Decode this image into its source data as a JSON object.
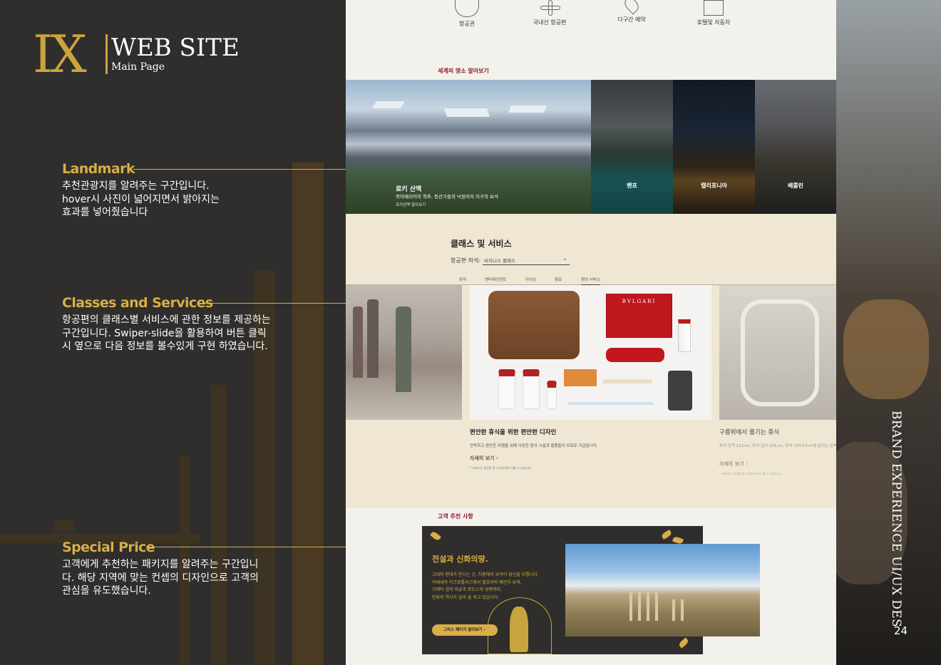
{
  "brand": {
    "mark": "IX",
    "title": "WEB SITE",
    "subtitle": "Main Page"
  },
  "annotations": [
    {
      "title": "Landmark",
      "text": "추천관광지를 알려주는 구간입니다.\nhover시 사진이 넓어지면서 밝아지는\n효과를 넣어줬습니다"
    },
    {
      "title": "Classes and Services",
      "text": "항공편의 클래스별 서비스에 관한 정보를 제공하는\n구간입니다. Swiper-slide을 활용하여 버튼 클릭\n시 옆으로 다음 정보를 볼수있게 구현 하였습니다."
    },
    {
      "title": "Special Price",
      "text": "고객에게 추천하는 패키지를 알려주는 구간입니\n다. 해당 지역에 맞는 컨셉의 디자인으로 고객의\n관심을 유도했습니다."
    }
  ],
  "quick_menu": [
    {
      "label": "항공권",
      "icon": "globe-icon"
    },
    {
      "label": "국내선 항공편",
      "icon": "airplane-icon"
    },
    {
      "label": "다구간 예약",
      "icon": "map-pin-icon"
    },
    {
      "label": "호텔및 자동차",
      "icon": "building-icon"
    }
  ],
  "landmark": {
    "section_label": "세계의 명소 알아보기",
    "featured": {
      "title": "로키 산맥",
      "desc": "북아메리카의 척추, 등산가들의 낙원이자 지구의 보석",
      "more": "로키산맥 알아보기"
    },
    "places": [
      "밴프",
      "캘리포니아",
      "베를린"
    ]
  },
  "classes": {
    "title": "클래스 및 서비스",
    "seat_label": "항공편 좌석:",
    "seat_value": "비지니스 클래스",
    "tabs": [
      "좌석",
      "엔터테인먼트",
      "다이닝",
      "음료",
      "편의 서비스"
    ],
    "product_brand": "BVLGARI",
    "slides": [
      {
        "title": "편안한 휴식을 위한 편안한 디자인",
        "desc": "안락하고 편안한 여행을 위해 다양한 편의 시설과 물품들이 무료로 지급됩니다.",
        "more": "자세히 보기",
        "note": "* 서비스는 항공편 및 노선에 따라 다를 수 있습니다."
      },
      {
        "title": "구름위에서 즐기는 휴식",
        "desc": "좌석 간격 211cm, 좌석 길이 201cm, 좌석 너비 67cm에 달하는 완벽한 평면 침대로 편안한 휴식을 제공합니다.",
        "more": "자세히 보기",
        "note": "* 서비스는 항공편 및 노선에 따라 다를 수 있습니다."
      }
    ]
  },
  "recommend": {
    "section_label": "고객 추천 사항",
    "title": "전설과 신화의땅.",
    "text": "고대와 현대가 만나는 곳, 지중해의 보석이 당신을 부릅니다.\n아테네의 아크로폴리스에서 델포이의 예언자 유적,\n크레타 섬의 미궁과 로도스의 성벽까지,\n인류의 역사가 살아 숨 쉬고 있습니다.",
    "button": "그리스 패키지 알아보기"
  },
  "side": {
    "vertical_text": "BRAND EXPERIENCE UI/UX DES",
    "page": "24"
  },
  "colors": {
    "gold": "#d8ae46",
    "panel": "#2f2e2c",
    "maroon": "#8c2230",
    "cream": "#efe6d3"
  }
}
